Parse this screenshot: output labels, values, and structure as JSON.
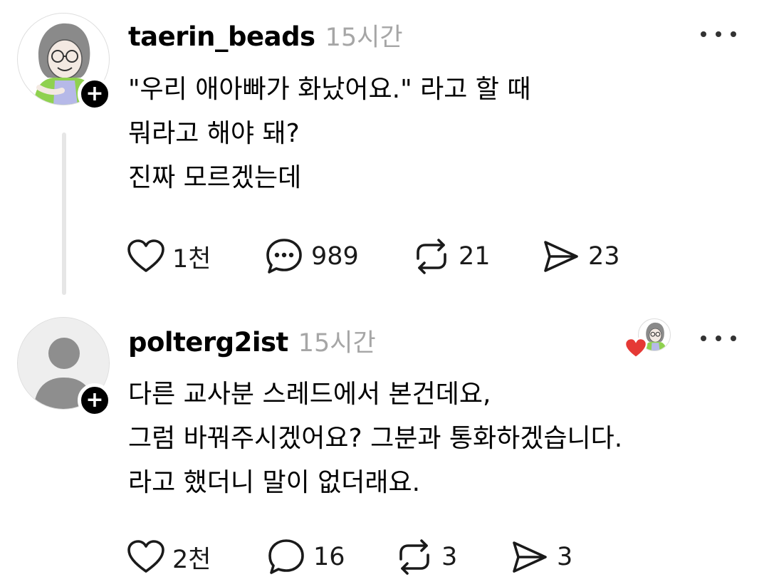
{
  "posts": [
    {
      "username": "taerin_beads",
      "time": "15시간",
      "lines": [
        "\"우리 애아빠가 화났어요.\" 라고 할 때",
        "뭐라고 해야 돼?",
        "진짜 모르겠는데"
      ],
      "actions": {
        "likes": "1천",
        "comments": "989",
        "reposts": "21",
        "shares": "23"
      }
    },
    {
      "username": "polterg2ist",
      "time": "15시간",
      "lines": [
        "다른 교사분 스레드에서 본건데요,",
        "그럼 바꿔주시겠어요? 그분과 통화하겠습니다.",
        "라고 했더니 말이 없더래요."
      ],
      "actions": {
        "likes": "2천",
        "comments": "16",
        "reposts": "3",
        "shares": "3"
      }
    }
  ],
  "icons": {
    "follow": "plus-icon",
    "more": "more-icon",
    "like": "heart-icon",
    "comment": "comment-icon",
    "repost": "repost-icon",
    "share": "send-icon",
    "liked_badge": "heart-badge-icon"
  },
  "colors": {
    "text": "#000000",
    "muted": "#a6a6a6",
    "thread_line": "#e6e6e6",
    "heart_badge": "#e53935",
    "follow_button": "#000000"
  }
}
